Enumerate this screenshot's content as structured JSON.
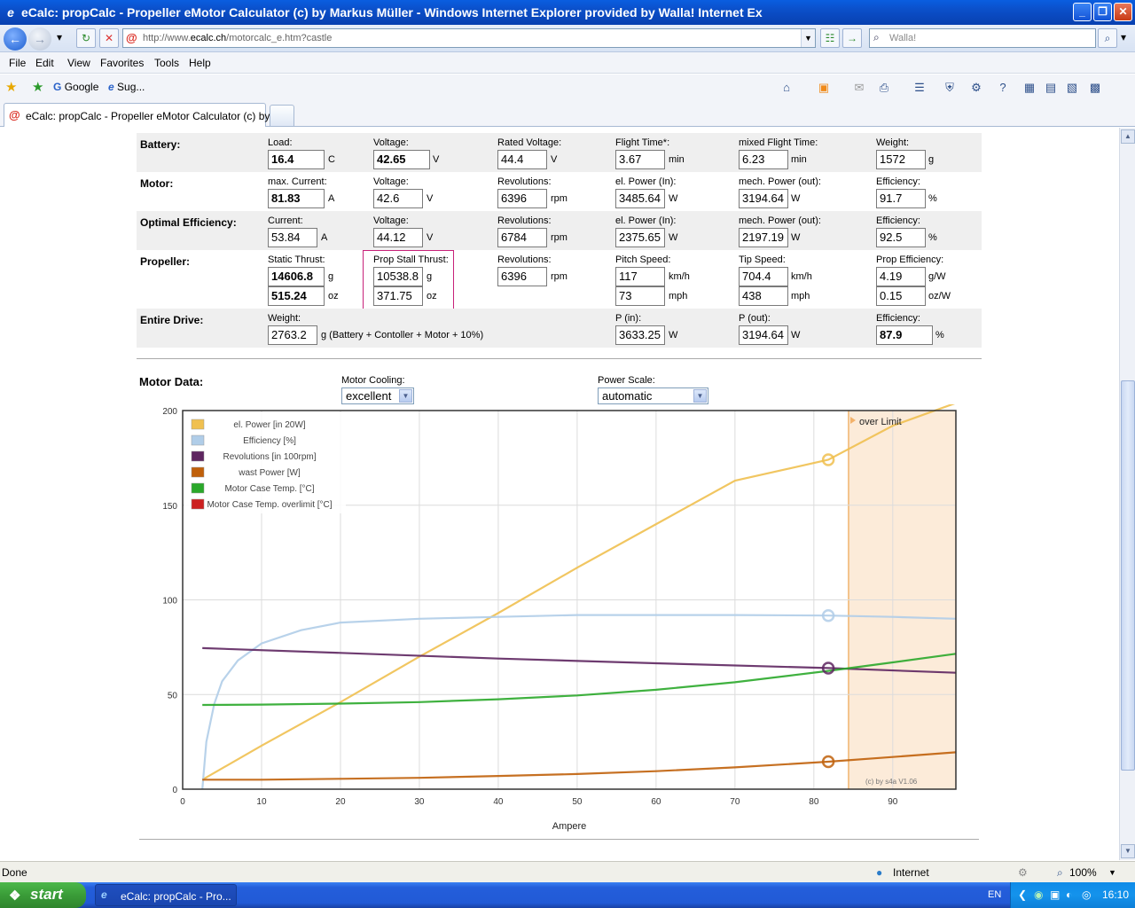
{
  "window": {
    "title": "eCalc: propCalc - Propeller eMotor Calculator   (c) by Markus Müller - Windows Internet Explorer provided by Walla! Internet Ex",
    "minimize": "_",
    "maximize": "❐",
    "close": "✕"
  },
  "address": {
    "url_prefix": "http://www.",
    "url_domain": "ecalc.ch",
    "url_path": "/motorcalc_e.htm?castle",
    "search_placeholder": "Walla!"
  },
  "menu": [
    "File",
    "Edit",
    "View",
    "Favorites",
    "Tools",
    "Help"
  ],
  "favorites": {
    "google": "Google",
    "suggested": "Sug..."
  },
  "tab": {
    "label": "eCalc: propCalc - Propeller eMotor Calculator   (c) by ..."
  },
  "colors": {
    "accent_box": "#c8227a",
    "power": "#f0c050",
    "efficiency": "#b0cde8",
    "revolutions": "#5e2660",
    "wast": "#c0600a",
    "temp": "#2aa82a",
    "overlimit": "#cc2020"
  },
  "battery": {
    "label": "Battery:",
    "load_cap": "Load:",
    "load": "16.4",
    "load_unit": "C",
    "voltage_cap": "Voltage:",
    "voltage": "42.65",
    "voltage_unit": "V",
    "rated_cap": "Rated Voltage:",
    "rated": "44.4",
    "rated_unit": "V",
    "flight_cap": "Flight Time*:",
    "flight": "3.67",
    "flight_unit": "min",
    "mixed_cap": "mixed Flight Time:",
    "mixed": "6.23",
    "mixed_unit": "min",
    "weight_cap": "Weight:",
    "weight": "1572",
    "weight_unit": "g"
  },
  "motor": {
    "label": "Motor:",
    "current_cap": "max. Current:",
    "current": "81.83",
    "current_unit": "A",
    "voltage_cap": "Voltage:",
    "voltage": "42.6",
    "voltage_unit": "V",
    "rev_cap": "Revolutions:",
    "rev": "6396",
    "rev_unit": "rpm",
    "elpower_cap": "el. Power (In):",
    "elpower": "3485.64",
    "elpower_unit": "W",
    "mech_cap": "mech. Power (out):",
    "mech": "3194.64",
    "mech_unit": "W",
    "eff_cap": "Efficiency:",
    "eff": "91.7",
    "eff_unit": "%"
  },
  "optimal": {
    "label": "Optimal Efficiency:",
    "current_cap": "Current:",
    "current": "53.84",
    "current_unit": "A",
    "voltage_cap": "Voltage:",
    "voltage": "44.12",
    "voltage_unit": "V",
    "rev_cap": "Revolutions:",
    "rev": "6784",
    "rev_unit": "rpm",
    "elpower_cap": "el. Power (In):",
    "elpower": "2375.65",
    "elpower_unit": "W",
    "mech_cap": "mech. Power (out):",
    "mech": "2197.19",
    "mech_unit": "W",
    "eff_cap": "Efficiency:",
    "eff": "92.5",
    "eff_unit": "%"
  },
  "propeller": {
    "label": "Propeller:",
    "static_cap": "Static Thrust:",
    "static_g": "14606.8",
    "static_oz": "515.24",
    "stall_cap": "Prop Stall Thrust:",
    "stall_g": "10538.8",
    "stall_oz": "371.75",
    "unit_g": "g",
    "unit_oz": "oz",
    "rev_cap": "Revolutions:",
    "rev": "6396",
    "rev_unit": "rpm",
    "pitch_cap": "Pitch Speed:",
    "pitch_kmh": "117",
    "pitch_mph": "73",
    "tip_cap": "Tip Speed:",
    "tip_kmh": "704.4",
    "tip_mph": "438",
    "unit_kmh": "km/h",
    "unit_mph": "mph",
    "peff_cap": "Prop Efficiency:",
    "peff_gw": "4.19",
    "peff_ozw": "0.15",
    "unit_gw": "g/W",
    "unit_ozw": "oz/W"
  },
  "drive": {
    "label": "Entire Drive:",
    "weight_cap": "Weight:",
    "weight": "2763.2",
    "weight_note": "g (Battery + Contoller + Motor + 10%)",
    "pin_cap": "P (in):",
    "pin": "3633.25",
    "pin_unit": "W",
    "pout_cap": "P (out):",
    "pout": "3194.64",
    "pout_unit": "W",
    "eff_cap": "Efficiency:",
    "eff": "87.9",
    "eff_unit": "%"
  },
  "motordata": {
    "title": "Motor Data:",
    "cooling_cap": "Motor Cooling:",
    "cooling_value": "excellent",
    "scale_cap": "Power Scale:",
    "scale_value": "automatic"
  },
  "chart_data": {
    "type": "line",
    "xlabel": "Ampere",
    "xlim": [
      0,
      98
    ],
    "ylim": [
      0,
      200
    ],
    "x_ticks": [
      0,
      10,
      20,
      30,
      40,
      50,
      60,
      70,
      80,
      90
    ],
    "y_ticks": [
      0,
      50,
      100,
      150,
      200
    ],
    "grid": true,
    "legend_position": "top-left",
    "over_limit_label": "over Limit",
    "over_limit_from": 84.4,
    "credit": "(c) by s4a    V1.06",
    "operating_point_x": 81.83,
    "series": [
      {
        "name": "el. Power [in 20W]",
        "color": "#f0c050",
        "x": [
          2.5,
          10,
          20,
          30,
          40,
          50,
          60,
          70,
          81.83,
          90,
          98
        ],
        "y": [
          5,
          23,
          46,
          70,
          93,
          117,
          140,
          163,
          174,
          192,
          204
        ]
      },
      {
        "name": "Efficiency [%]",
        "color": "#b0cde8",
        "x": [
          2.5,
          3,
          4,
          5,
          7,
          10,
          15,
          20,
          30,
          40,
          50,
          60,
          70,
          81.83,
          90,
          98
        ],
        "y": [
          0,
          25,
          45,
          57,
          68,
          77,
          84,
          88,
          90,
          91,
          92,
          92,
          92,
          91.7,
          91,
          90
        ]
      },
      {
        "name": "Revolutions [in 100rpm]",
        "color": "#5e2660",
        "x": [
          2.5,
          20,
          40,
          60,
          81.83,
          98
        ],
        "y": [
          74.5,
          72,
          69,
          66.5,
          63.96,
          61.5
        ]
      },
      {
        "name": "wast Power [W]",
        "color": "#c0600a",
        "x": [
          2.5,
          10,
          20,
          30,
          40,
          50,
          60,
          70,
          81.83,
          90,
          98
        ],
        "y": [
          5,
          5,
          5.5,
          6,
          7,
          8,
          9.5,
          11.5,
          14.5,
          17,
          19.5
        ]
      },
      {
        "name": "Motor Case Temp. [°C]",
        "color": "#2aa82a",
        "x": [
          2.5,
          10,
          20,
          30,
          40,
          50,
          60,
          70,
          81.83,
          90,
          98
        ],
        "y": [
          44.5,
          44.7,
          45.2,
          46,
          47.5,
          49.5,
          52.5,
          56.5,
          62.5,
          67,
          71.5
        ]
      },
      {
        "name": "Motor Case Temp. overlimit [°C]",
        "color": "#cc2020",
        "x": [],
        "y": []
      }
    ]
  },
  "status": {
    "left": "Done",
    "zone": "Internet",
    "zoom": "100%"
  },
  "taskbar": {
    "start": "start",
    "item": "eCalc: propCalc - Pro...",
    "lang": "EN",
    "clock": "16:10"
  }
}
